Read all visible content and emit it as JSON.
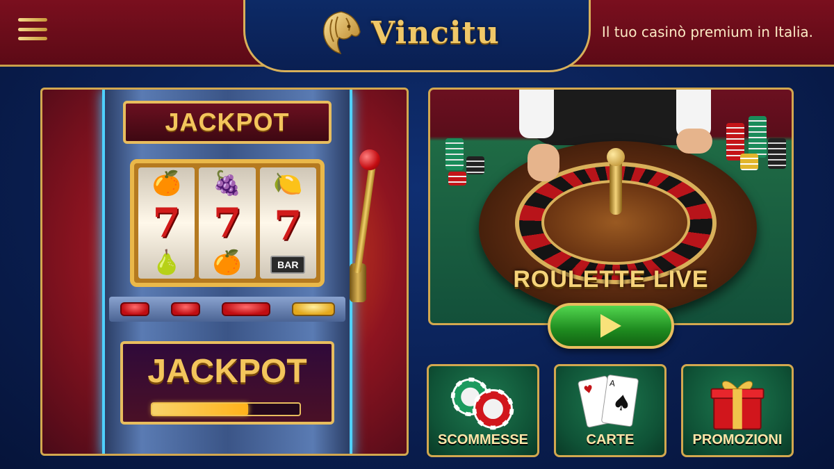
{
  "header": {
    "brand": "Vincitu",
    "tagline": "Il tuo casinò premium in Italia.",
    "menu_icon": "hamburger-menu-icon",
    "logo_icon": "lion-head-icon"
  },
  "slot": {
    "top_label": "JACKPOT",
    "bottom_label": "JACKPOT",
    "reels": [
      [
        "🍊",
        "7",
        "🍐"
      ],
      [
        "🍇",
        "7",
        "🍊"
      ],
      [
        "🍋",
        "7",
        "BAR"
      ]
    ],
    "jackpot_progress": 0.65
  },
  "roulette": {
    "title": "ROULETTE LIVE",
    "play_icon": "play-icon"
  },
  "categories": [
    {
      "label": "SCOMMESSE",
      "icon": "casino-chips-icon"
    },
    {
      "label": "CARTE",
      "icon": "playing-cards-icon"
    },
    {
      "label": "PROMOZIONI",
      "icon": "gift-box-icon"
    }
  ],
  "colors": {
    "gold": "#d3a84f",
    "header_red": "#7a0f1e",
    "background_blue": "#0a1f52",
    "play_green": "#1e8a1f"
  }
}
